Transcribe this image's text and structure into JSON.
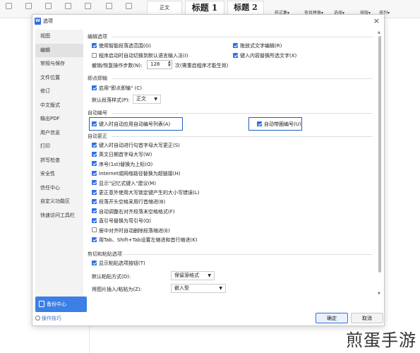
{
  "toolbar": {
    "small_labels": [
      "样式集▾",
      "查找替换▾",
      "选择▾",
      "排版▾",
      "排列▾"
    ],
    "styles": {
      "normal": "正文",
      "heading1": "标题 1",
      "heading2": "标题 2"
    }
  },
  "dialog": {
    "title": "选项",
    "close": "×",
    "sidebar": [
      "视图",
      "编辑",
      "常规与保存",
      "文件位置",
      "修订",
      "中文版式",
      "输出PDF",
      "用户信息",
      "打印",
      "拼写检查",
      "安全性",
      "信任中心",
      "自定义功能区",
      "快速访问工具栏"
    ],
    "active_sidebar": "编辑",
    "backup_button": "备份中心",
    "tips": "操作技巧",
    "sections": {
      "edit_options": {
        "title": "编辑选项",
        "smart_para": "使用智能段落选范围(G)",
        "drag_text": "拖放式文字编辑(R)",
        "auto_switch_ime": "程序启动时自动切换到默认语言输入法(I)",
        "replace_selection": "键入内容替换所选文字(X)",
        "undo_label": "撤销/恢复操作步数(N):",
        "undo_value": "128",
        "undo_note": "次(需重启程序才能生效)"
      },
      "click_type": {
        "title": "即点即输",
        "enable": "启用\"即点即输\" (C)",
        "default_style_label": "默认段落样式(P):",
        "default_style_value": "正文"
      },
      "auto_number": {
        "title": "自动编号",
        "auto_list": "键入时自动应用自动编号列表(A)",
        "circled": "自动带圈编号(U)"
      },
      "auto_correct": {
        "title": "自动更正",
        "items": [
          "键入时自动进行句首字母大写更正(S)",
          "英文日期首字母大写(W)",
          "序号(1st)替换为上标(O)",
          "Internet或网络路径替换为超链接(H)",
          "显示\"记忆式键入\"建议(M)",
          "更正意外使用大写锁定键产生的大小写错误(L)",
          "段落开头空格采用行首缩进(B)",
          "自动调整右对齐段落末空格格式(F)",
          "直引号替换为弯引号(Q)",
          "居中对齐时自动删除段落缩进(E)",
          "用Tab、Shift+Tab设置左缩进和首行缩进(K)"
        ],
        "checked": [
          true,
          true,
          true,
          true,
          true,
          true,
          true,
          true,
          true,
          false,
          true
        ]
      },
      "paste": {
        "title": "剪切和粘贴选项",
        "show_button": "显示粘贴选项按钮(T)",
        "default_paste_label": "默认粘贴方式(D):",
        "default_paste_value": "保留源格式",
        "image_insert_label": "将图片插入/粘贴为(Z):",
        "image_insert_value": "嵌入型"
      }
    },
    "ok": "确定",
    "cancel": "取消"
  },
  "watermark": "煎蛋手游",
  "colors": {
    "accent": "#2f6fe0",
    "highlight_border": "#1f5fbf",
    "backup_button": "#3c7fe6"
  }
}
